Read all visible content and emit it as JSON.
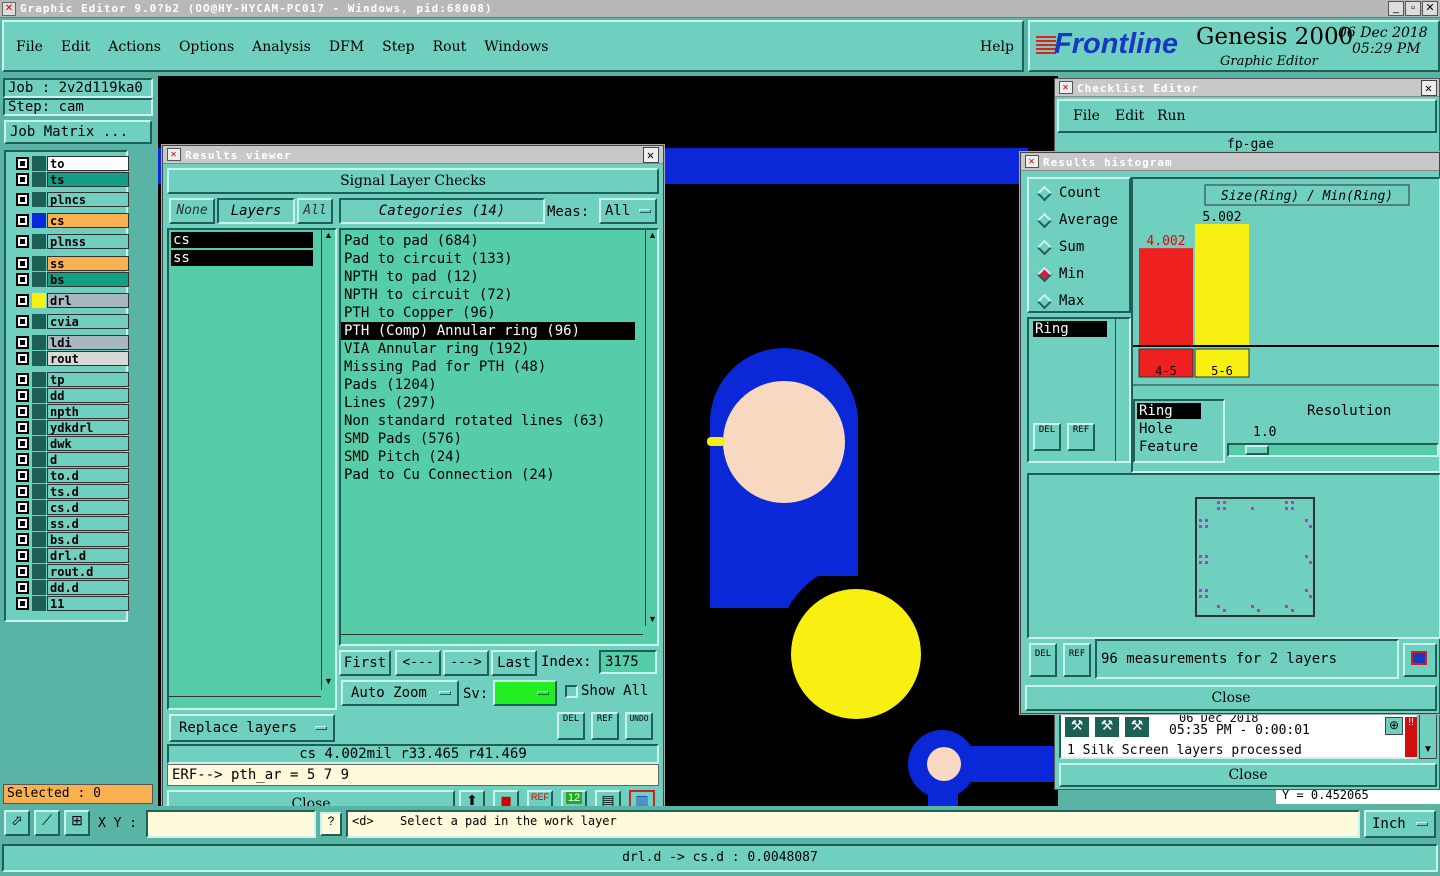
{
  "window": {
    "title": "Graphic Editor 9.0?b2 (OO@HY-HYCAM-PC017 - Windows, pid:68008)"
  },
  "menu": [
    "File",
    "Edit",
    "Actions",
    "Options",
    "Analysis",
    "DFM",
    "Step",
    "Rout",
    "Windows"
  ],
  "help": "Help",
  "brand": {
    "logo": "Frontline",
    "product": "Genesis 2000",
    "sub": "Graphic Editor",
    "date": "06 Dec 2018",
    "time": "05:29 PM"
  },
  "job": {
    "job": "Job : 2v2d119ka0",
    "step": "Step: cam",
    "matrix": "Job Matrix ..."
  },
  "layers": [
    {
      "name": "to",
      "bg": "#ffffff",
      "mark": "#1b5f55"
    },
    {
      "name": "ts",
      "bg": "#139f83",
      "mark": "#1b5f55"
    },
    {
      "name": "plncs",
      "bg": "#6fd0c0",
      "mark": "#1b5f55"
    },
    {
      "name": "cs",
      "bg": "#f8b050",
      "mark": "#0a28d8"
    },
    {
      "name": "plnss",
      "bg": "#6fd0c0",
      "mark": "#1b5f55"
    },
    {
      "name": "ss",
      "bg": "#f8b050",
      "mark": "#1b5f55"
    },
    {
      "name": "bs",
      "bg": "#139f83",
      "mark": "#1b5f55"
    },
    {
      "name": "drl",
      "bg": "#a8b8c0",
      "mark": "#f8f010"
    },
    {
      "name": "cvia",
      "bg": "#6fd0c0",
      "mark": "#1b5f55"
    },
    {
      "name": "ldi",
      "bg": "#a8b8c0",
      "mark": "#1b5f55"
    },
    {
      "name": "rout",
      "bg": "#d8d8d8",
      "mark": "#1b5f55"
    },
    {
      "name": "tp",
      "bg": "#6fd0c0",
      "mark": "#1b5f55"
    },
    {
      "name": "dd",
      "bg": "#6fd0c0",
      "mark": "#1b5f55"
    },
    {
      "name": "npth",
      "bg": "#6fd0c0",
      "mark": "#1b5f55"
    },
    {
      "name": "ydkdrl",
      "bg": "#6fd0c0",
      "mark": "#1b5f55"
    },
    {
      "name": "dwk",
      "bg": "#6fd0c0",
      "mark": "#1b5f55"
    },
    {
      "name": "d",
      "bg": "#6fd0c0",
      "mark": "#1b5f55"
    },
    {
      "name": "to.d",
      "bg": "#6fd0c0",
      "mark": "#1b5f55"
    },
    {
      "name": "ts.d",
      "bg": "#6fd0c0",
      "mark": "#1b5f55"
    },
    {
      "name": "cs.d",
      "bg": "#6fd0c0",
      "mark": "#1b5f55"
    },
    {
      "name": "ss.d",
      "bg": "#6fd0c0",
      "mark": "#1b5f55"
    },
    {
      "name": "bs.d",
      "bg": "#6fd0c0",
      "mark": "#1b5f55"
    },
    {
      "name": "drl.d",
      "bg": "#6fd0c0",
      "mark": "#1b5f55"
    },
    {
      "name": "rout.d",
      "bg": "#6fd0c0",
      "mark": "#1b5f55"
    },
    {
      "name": "dd.d",
      "bg": "#6fd0c0",
      "mark": "#1b5f55"
    },
    {
      "name": "11",
      "bg": "#6fd0c0",
      "mark": "#1b5f55"
    }
  ],
  "selected": "Selected : 0",
  "xy_label": "X Y :",
  "hint": "Select a pad in the work layer",
  "hint_prefix": "<d>",
  "unit": "Inch",
  "status_bar": "drl.d -> cs.d : 0.0048087",
  "results_viewer": {
    "title": "Results viewer",
    "heading": "Signal Layer Checks",
    "none": "None",
    "layers": "Layers",
    "all": "All",
    "categories": "Categories (14)",
    "meas_label": "Meas:",
    "meas_value": "All",
    "layer_list": [
      "cs",
      "ss"
    ],
    "category_list": [
      "Pad to pad (684)",
      "Pad to circuit (133)",
      "NPTH to pad (12)",
      "NPTH to circuit (72)",
      "PTH to Copper (96)",
      "PTH (Comp) Annular ring (96)",
      "VIA Annular ring (192)",
      "Missing Pad for PTH (48)",
      "Pads (1204)",
      "Lines (297)",
      "Non standard rotated lines (63)",
      "SMD Pads (576)",
      "SMD Pitch (24)",
      "Pad to Cu Connection (24)"
    ],
    "selected_category": 5,
    "first": "First",
    "prev": "<---",
    "next": "--->",
    "last": "Last",
    "index_label": "Index:",
    "index_value": "3175",
    "auto_zoom": "Auto Zoom",
    "sv_label": "Sv:",
    "show_all": "Show All",
    "replace_layers": "Replace layers",
    "del": "DEL",
    "ref": "REF",
    "undo": "UNDO",
    "measure": "cs 4.002mil  r33.465  r41.469",
    "erf": "ERF--> pth_ar = 5 7 9",
    "close": "Close"
  },
  "checklist_editor": {
    "title": "Checklist Editor",
    "menu": [
      "File",
      "Edit",
      "Run"
    ],
    "item": "fp-gae",
    "log_date": "06 Dec 2018",
    "log_time": "05:35 PM - 0:00:01",
    "log_msg": "1 Silk Screen layers processed",
    "close": "Close",
    "y_readout": "Y = 0.452065"
  },
  "histogram": {
    "title": "Results histogram",
    "options": [
      "Count",
      "Average",
      "Sum",
      "Min",
      "Max"
    ],
    "selected_option": 3,
    "list1": [
      "Ring"
    ],
    "chart_title": "Size(Ring) / Min(Ring)",
    "bars": [
      {
        "label": "4-5",
        "value": 4.002,
        "value_text": "4.002",
        "color": "#ee2020"
      },
      {
        "label": "5-6",
        "value": 5.002,
        "value_text": "5.002",
        "color": "#f8f010"
      }
    ],
    "list2": [
      "Ring",
      "Hole",
      "Feature"
    ],
    "resolution_label": "Resolution",
    "resolution_value": "1.0",
    "del": "DEL",
    "ref": "REF",
    "summary": "96 measurements for 2 layers",
    "close": "Close"
  },
  "colors": {
    "bg": "#5ab4a6",
    "panel": "#6fd0c0",
    "list": "#55cda8",
    "canvas": "#000000",
    "copper": "#0a28d8",
    "pad": "#f8d8c0",
    "drill": "#f8f010"
  }
}
